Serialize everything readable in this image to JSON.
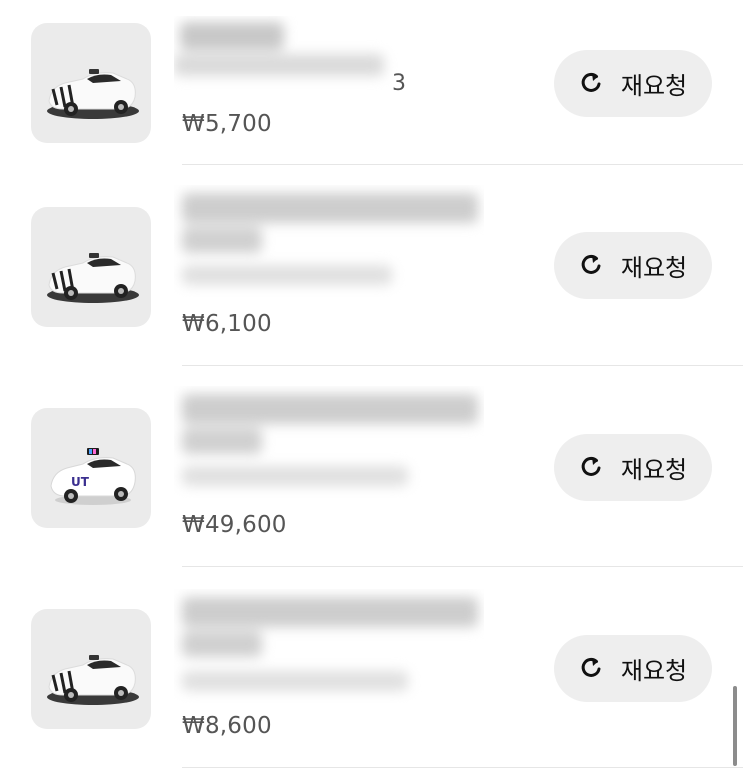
{
  "rides": [
    {
      "price": "₩5,700",
      "partial_detail": "3",
      "rerequest_label": "재요청",
      "vehicle_icon": "car-icon"
    },
    {
      "price": "₩6,100",
      "rerequest_label": "재요청",
      "vehicle_icon": "car-icon"
    },
    {
      "price": "₩49,600",
      "rerequest_label": "재요청",
      "vehicle_icon": "ut-taxi-icon"
    },
    {
      "price": "₩8,600",
      "rerequest_label": "재요청",
      "vehicle_icon": "car-icon"
    }
  ]
}
